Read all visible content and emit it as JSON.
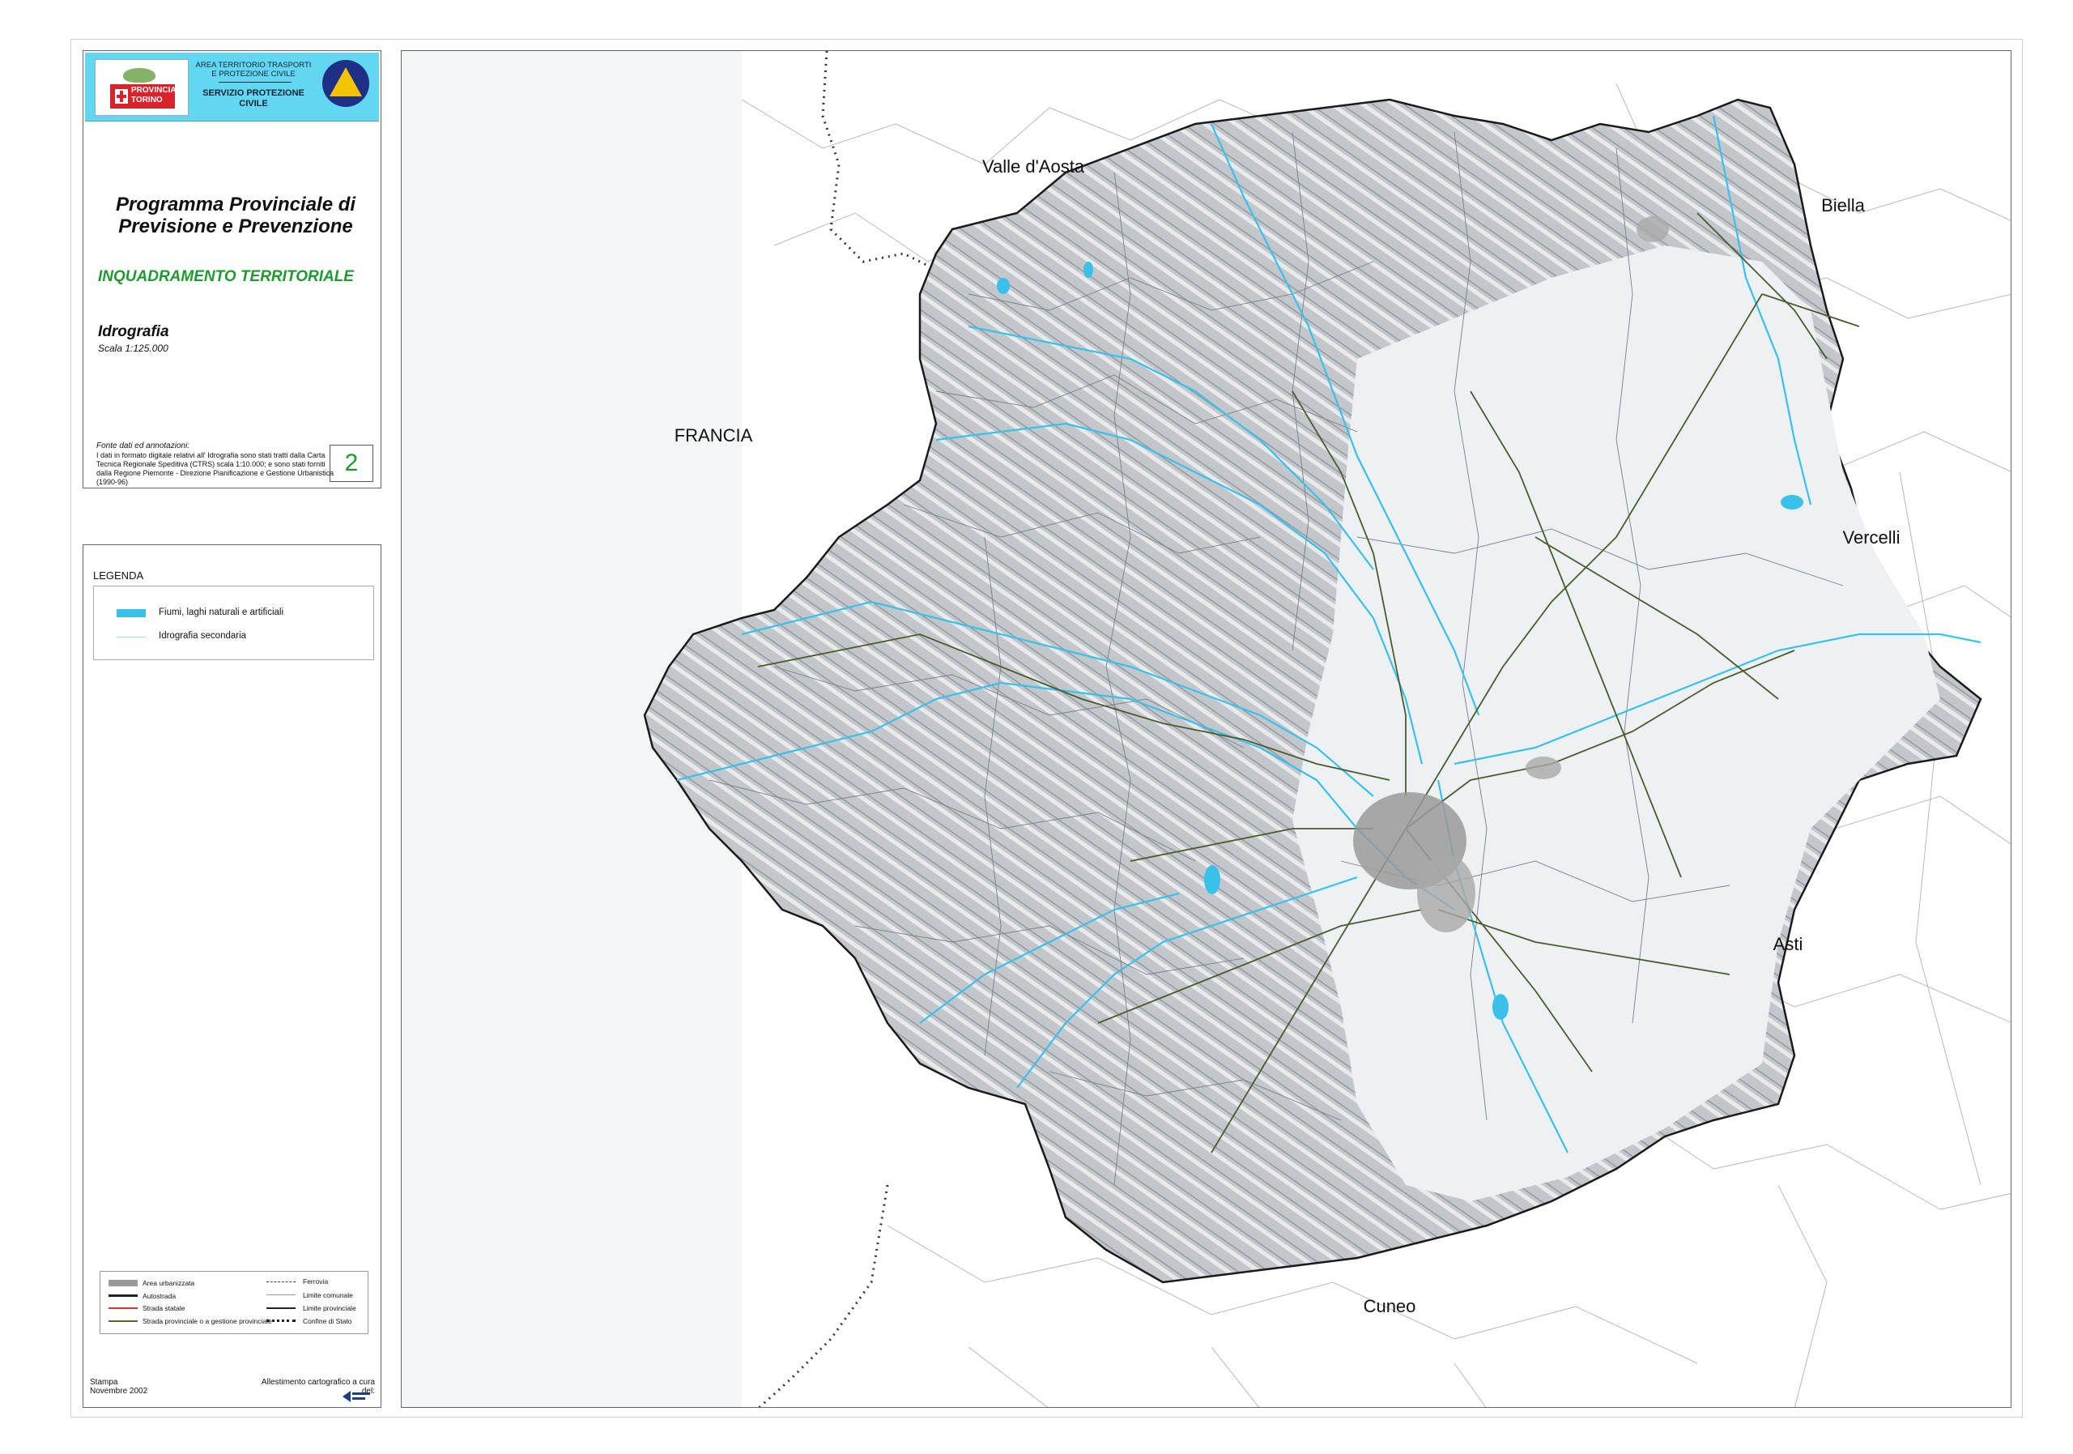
{
  "header": {
    "logo_text": "PROVINCIA DI TORINO",
    "agency": "AREA TERRITORIO TRASPORTI E PROTEZIONE CIVILE",
    "service": "SERVIZIO PROTEZIONE CIVILE"
  },
  "title": {
    "program": "Programma Provinciale di Previsione e Prevenzione",
    "subject": "INQUADRAMENTO TERRITORIALE",
    "theme": "Idrografia",
    "scale": "Scala 1:125.000"
  },
  "notes": {
    "heading": "Fonte dati ed annotazioni:",
    "text": "I dati in formato digitale relativi all' Idrografia sono stati tratti dalla Carta Tecnica Regionale Speditiva (CTRS) scala 1:10.000; e sono stati forniti dalla Regione Piemonte - Direzione Pianificazione e Gestione Urbanistica (1990-96)"
  },
  "sheet_number": "2",
  "legend": {
    "title": "LEGENDA",
    "items": [
      {
        "label": "Fiumi, laghi naturali e artificiali",
        "color": "#39c1ea"
      },
      {
        "label": "Idrografia secondaria",
        "color": "#9be3f5"
      }
    ],
    "reference": [
      {
        "label": "Area urbanizzata"
      },
      {
        "label": "Autostrada"
      },
      {
        "label": "Strada statale"
      },
      {
        "label": "Strada provinciale o a gestione provinciale"
      },
      {
        "label": "Ferrovia"
      },
      {
        "label": "Limite comunale"
      },
      {
        "label": "Limite provinciale"
      },
      {
        "label": "Confine di Stato"
      }
    ]
  },
  "footer": {
    "print_label": "Stampa",
    "print_date": "Novembre 2002",
    "credits": "Allestimento cartografico a cura del:"
  },
  "map": {
    "labels": {
      "valle_aosta": "Valle d'Aosta",
      "biella": "Biella",
      "francia": "FRANCIA",
      "vercelli": "Vercelli",
      "asti": "Asti",
      "cuneo": "Cuneo"
    },
    "colors": {
      "terrain": "#c9ccd0",
      "plain": "#eef1f3",
      "water": "#39c1ea",
      "roads": "#4d5a2c",
      "boundary": "#222222"
    }
  }
}
